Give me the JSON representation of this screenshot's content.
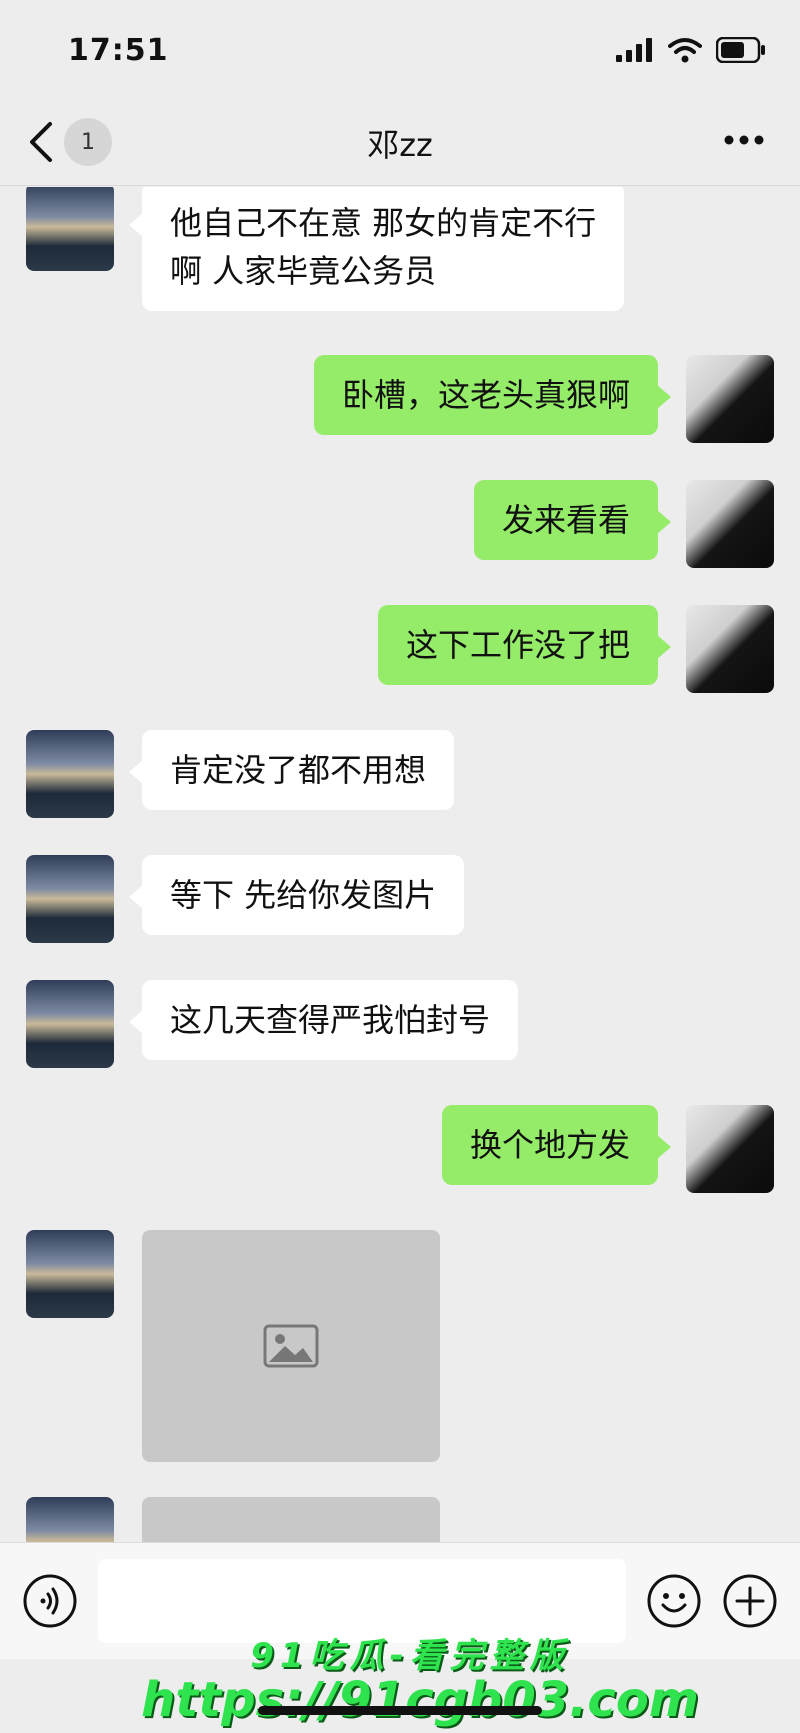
{
  "status_bar": {
    "time": "17:51"
  },
  "header": {
    "unread_count": "1",
    "title": "邓zz"
  },
  "messages": [
    {
      "side": "left",
      "type": "text",
      "text": "他自己不在意 那女的肯定不行\n啊 人家毕竟公务员"
    },
    {
      "side": "right",
      "type": "text",
      "text": "卧槽，这老头真狠啊"
    },
    {
      "side": "right",
      "type": "text",
      "text": "发来看看"
    },
    {
      "side": "right",
      "type": "text",
      "text": "这下工作没了把"
    },
    {
      "side": "left",
      "type": "text",
      "text": "肯定没了都不用想"
    },
    {
      "side": "left",
      "type": "text",
      "text": "等下 先给你发图片"
    },
    {
      "side": "left",
      "type": "text",
      "text": "这几天查得严我怕封号"
    },
    {
      "side": "right",
      "type": "text",
      "text": "换个地方发"
    },
    {
      "side": "left",
      "type": "image"
    },
    {
      "side": "left",
      "type": "image"
    }
  ],
  "input_bar": {
    "value": ""
  },
  "watermark": {
    "line1": "91吃瓜-看完整版",
    "line2": "https://91cgb03.com"
  },
  "colors": {
    "self_bubble": "#95ec69",
    "contact_bubble": "#ffffff",
    "background": "#ededed"
  }
}
